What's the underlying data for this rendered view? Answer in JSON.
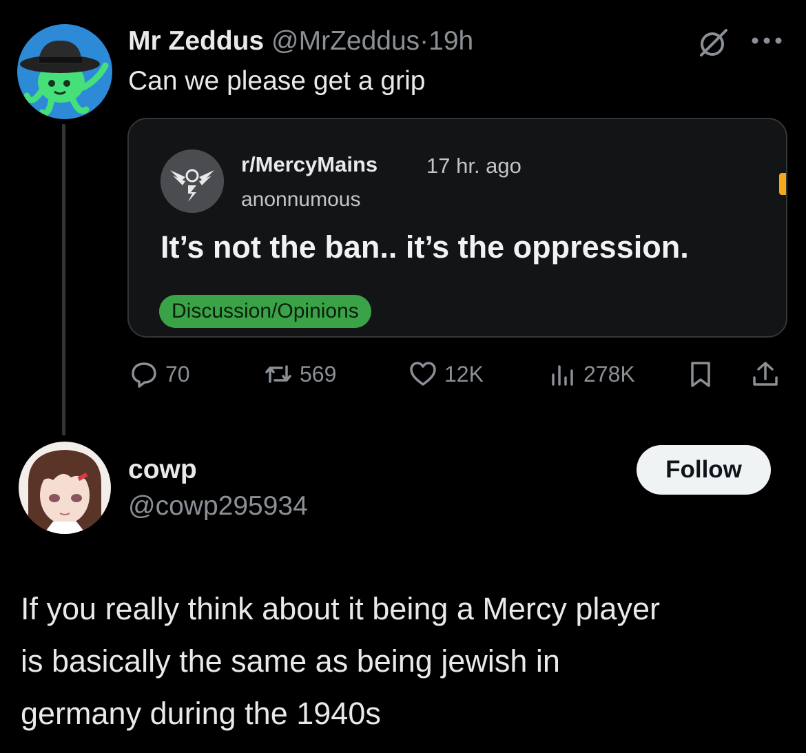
{
  "tweet1": {
    "name": "Mr Zeddus",
    "handle": "@MrZeddus",
    "separator": "·",
    "time": "19h",
    "text": "Can we please get a grip",
    "embed": {
      "subreddit": "r/MercyMains",
      "time": "17 hr. ago",
      "user": "anonnumous",
      "title": "It’s not the ban.. it’s the oppression.",
      "flair": "Discussion/Opinions",
      "flair_color": "#3aa348"
    },
    "actions": {
      "replies": "70",
      "retweets": "569",
      "likes": "12K",
      "views": "278K"
    }
  },
  "tweet2": {
    "name": "cowp",
    "handle": "@cowp295934",
    "follow_label": "Follow",
    "text_lines": [
      "If you really think about it being a Mercy player",
      "is basically the same as being jewish in",
      "germany during the 1940s"
    ]
  },
  "icons": [
    "grok-icon",
    "more-icon",
    "reply-icon",
    "retweet-icon",
    "like-icon",
    "views-icon",
    "bookmark-icon",
    "share-icon"
  ],
  "colors": {
    "background": "#000000",
    "text": "#e7e9ea",
    "muted": "#8b9096",
    "border": "#333639"
  }
}
